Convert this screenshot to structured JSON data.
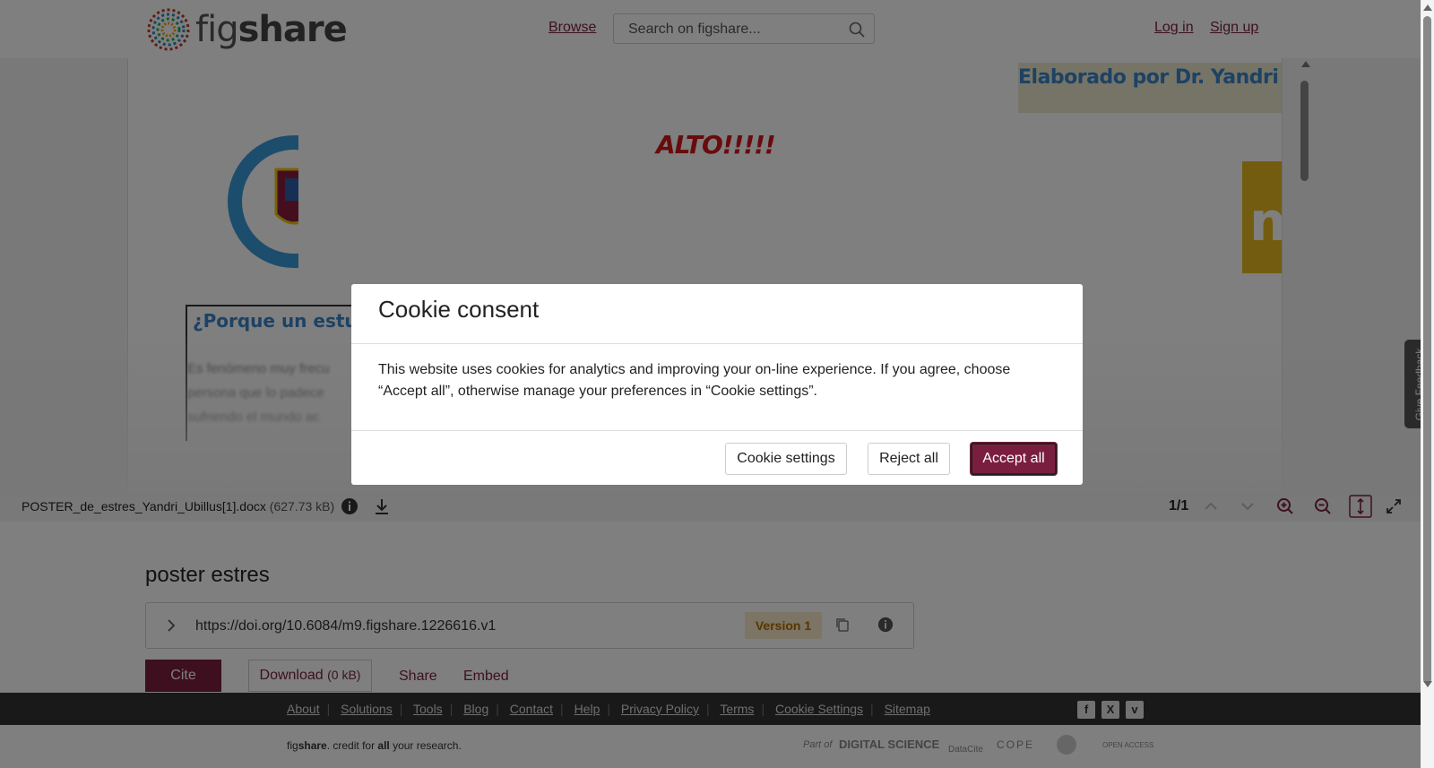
{
  "header": {
    "logo_text_light": "fig",
    "logo_text_bold": "share",
    "browse": "Browse",
    "search_placeholder": "Search on figshare...",
    "login": "Log in",
    "signup": "Sign up"
  },
  "document": {
    "elaborado": "Elaborado por Dr. Yandri Ubillus",
    "alto": "ALTO!!!!!",
    "porque": "¿Porque un estudio",
    "body_lines": [
      "Es fenómeno muy frecu",
      "persona que lo padece",
      "sufriendo el mundo ac"
    ],
    "msp_logo": "msp"
  },
  "viewer_toolbar": {
    "filename": "POSTER_de_estres_Yandri_Ubillus[1].docx",
    "filesize": "(627.73 kB)",
    "page_count": "1/1"
  },
  "item": {
    "title": "poster estres",
    "doi": "https://doi.org/10.6084/m9.figshare.1226616.v1",
    "version": "Version 1",
    "cite": "Cite",
    "download": "Download",
    "download_size": "(0 kB)",
    "share": "Share",
    "embed": "Embed"
  },
  "footer": {
    "links": [
      "About",
      "Solutions",
      "Tools",
      "Blog",
      "Contact",
      "Help",
      "Privacy Policy",
      "Terms",
      "Cookie Settings",
      "Sitemap"
    ],
    "social": [
      "facebook-icon",
      "x-icon",
      "vimeo-icon"
    ],
    "tagline_pre": "fig",
    "tagline_bold": "share",
    "tagline_mid": ". credit for ",
    "tagline_all": "all",
    "tagline_post": " your research.",
    "partners": [
      "Part of",
      "DIGITAL SCIENCE",
      "DataCite",
      "COPE",
      "OPEN ACCESS"
    ]
  },
  "feedback": "Give Feedback",
  "cookie_modal": {
    "title": "Cookie consent",
    "body": "This website uses cookies for analytics and improving your on-line experience. If you agree, choose “Accept all”, otherwise manage your preferences in “Cookie settings”.",
    "settings": "Cookie settings",
    "reject": "Reject all",
    "accept": "Accept all"
  },
  "colors": {
    "brand": "#7a1e3f",
    "version_bg": "#f8e9c9",
    "version_text": "#b06a00"
  }
}
